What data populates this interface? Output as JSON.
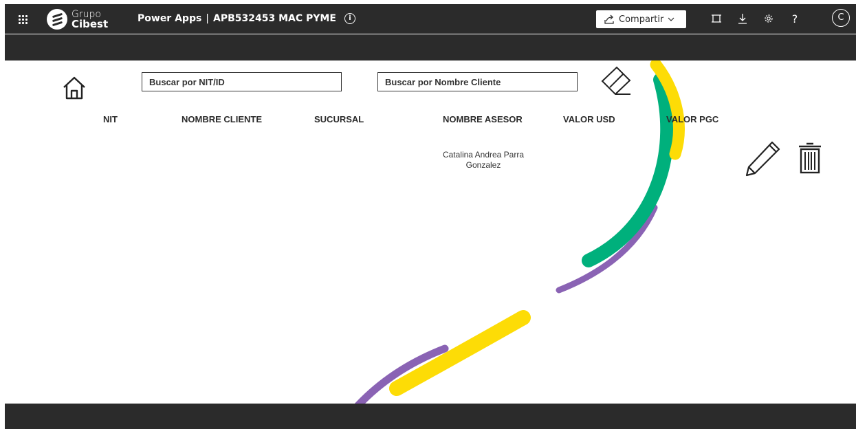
{
  "header": {
    "logo_line1": "Grupo",
    "logo_line2": "Cibest",
    "app_name": "Power Apps",
    "separator": "|",
    "app_title": "APB532453 MAC PYME",
    "share_label": "Compartir",
    "avatar_initial": "C"
  },
  "toolbar": {
    "search_nit_placeholder": "Buscar por NIT/ID",
    "search_name_placeholder": "Buscar por Nombre Cliente"
  },
  "table": {
    "columns": [
      "NIT",
      "NOMBRE CLIENTE",
      "SUCURSAL",
      "NOMBRE ASESOR",
      "VALOR USD",
      "VALOR PGC"
    ],
    "rows": [
      {
        "nit": "",
        "nombre_cliente": "",
        "sucursal": "",
        "nombre_asesor": "Catalina Andrea Parra Gonzalez",
        "valor_usd": "",
        "valor_pgc": ""
      }
    ]
  },
  "icons": {
    "waffle": "app-launcher-icon",
    "info": "info-icon",
    "share": "share-icon",
    "fit": "fit-to-screen-icon",
    "download": "download-icon",
    "settings": "gear-icon",
    "help": "help-icon",
    "home": "home-icon",
    "eraser": "eraser-icon",
    "edit": "pencil-icon",
    "delete": "trash-icon"
  },
  "colors": {
    "header_bg": "#2b2b2b",
    "stripe_yellow": "#fddc06",
    "stripe_green": "#00b07c",
    "stripe_purple": "#8a63b4"
  }
}
